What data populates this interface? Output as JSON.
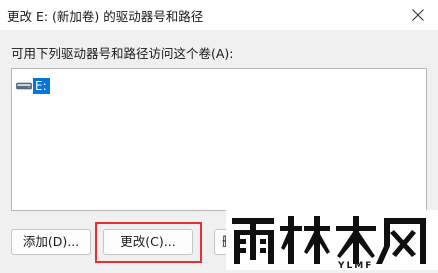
{
  "window": {
    "title": "更改 E: (新加卷) 的驱动器号和路径"
  },
  "prompt": "可用下列驱动器号和路径访问这个卷(A):",
  "list": {
    "items": [
      {
        "label": "E:",
        "icon": "drive-icon",
        "selected": true
      }
    ]
  },
  "buttons": {
    "add": "添加(D)...",
    "change": "更改(C)...",
    "delete": "删"
  },
  "watermark": {
    "text": "雨林木风",
    "subtext": "YLMF"
  },
  "colors": {
    "highlight": "#e53030",
    "selection": "#0a73d7"
  }
}
